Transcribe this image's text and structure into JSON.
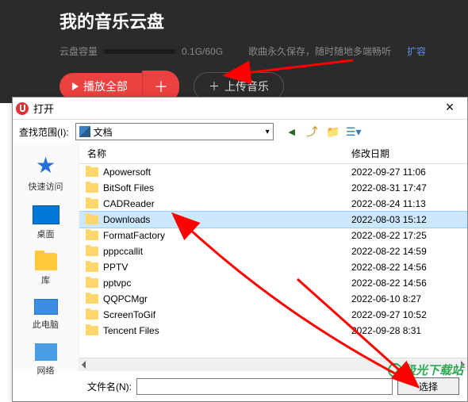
{
  "cloud": {
    "title": "我的音乐云盘",
    "capacity_label": "云盘容量",
    "capacity_text": "0.1G/60G",
    "slogan": "歌曲永久保存，随时随地多端畅听",
    "expand": "扩容",
    "play_all": "播放全部",
    "plus": "＋",
    "upload": "上传音乐",
    "upload_plus": "＋"
  },
  "dialog": {
    "title": "打开",
    "close": "×",
    "lookin_label": "查找范围(I):",
    "lookin_value": "文档",
    "col_name": "名称",
    "col_date": "修改日期",
    "filename_label": "文件名(N):",
    "filename_value": "",
    "select_btn": "选择",
    "sidebar": [
      {
        "label": "快速访问",
        "icon": "star"
      },
      {
        "label": "桌面",
        "icon": "desktop"
      },
      {
        "label": "库",
        "icon": "lib"
      },
      {
        "label": "此电脑",
        "icon": "pc"
      },
      {
        "label": "网络",
        "icon": "net"
      }
    ],
    "files": [
      {
        "name": "Apowersoft",
        "date": "2022-09-27 11:06",
        "selected": false
      },
      {
        "name": "BitSoft Files",
        "date": "2022-08-31 17:47",
        "selected": false
      },
      {
        "name": "CADReader",
        "date": "2022-08-24 11:13",
        "selected": false
      },
      {
        "name": "Downloads",
        "date": "2022-08-03 15:12",
        "selected": true
      },
      {
        "name": "FormatFactory",
        "date": "2022-08-22 17:25",
        "selected": false
      },
      {
        "name": "pppccallit",
        "date": "2022-08-22 14:59",
        "selected": false
      },
      {
        "name": "PPTV",
        "date": "2022-08-22 14:56",
        "selected": false
      },
      {
        "name": "pptvpc",
        "date": "2022-08-22 14:56",
        "selected": false
      },
      {
        "name": "QQPCMgr",
        "date": "2022-06-10 8:27",
        "selected": false
      },
      {
        "name": "ScreenToGif",
        "date": "2022-09-27 10:52",
        "selected": false
      },
      {
        "name": "Tencent Files",
        "date": "2022-09-28 8:31",
        "selected": false
      }
    ]
  },
  "watermark": "极光下载站"
}
